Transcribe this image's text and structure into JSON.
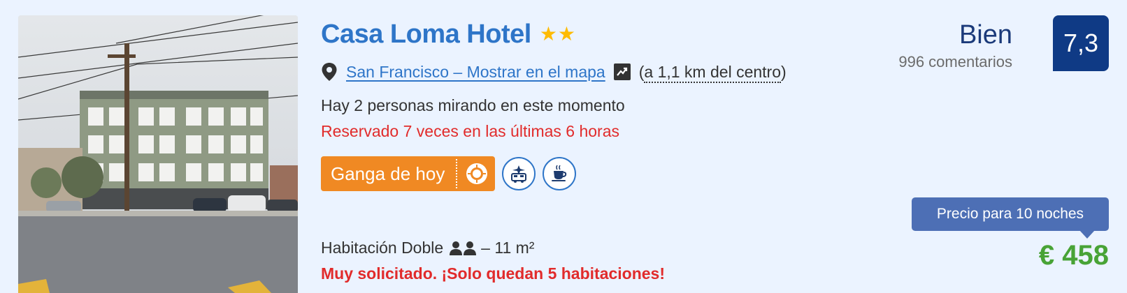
{
  "hotel": {
    "name": "Casa Loma Hotel",
    "stars": 2,
    "star_color": "#febb02",
    "name_color": "#2e75c8"
  },
  "location": {
    "map_link": "San Francisco – Mostrar en el mapa",
    "distance": "a 1,1 km del centro",
    "open_paren": "(",
    "close_paren": ")",
    "icons": [
      "map-pin-icon",
      "map-view-icon"
    ]
  },
  "activity": {
    "viewers": "Hay 2 personas mirando en este momento",
    "booked": "Reservado 7 veces en las últimas 6 horas"
  },
  "badges": {
    "deal_label": "Ganga de hoy",
    "deal_color": "#f08923",
    "icons": [
      "deal-sun-icon",
      "airport-shuttle-icon",
      "coffee-cup-icon"
    ]
  },
  "room": {
    "name": "Habitación Doble",
    "size": "– 11 m²",
    "occupancy_icon": "two-people-icon",
    "scarcity": "Muy solicitado. ¡Solo quedan 5 habitaciones!"
  },
  "rating": {
    "label": "Bien",
    "reviews": "996 comentarios",
    "score": "7,3",
    "badge_color": "#0f3a85"
  },
  "price": {
    "tooltip": "Precio para 10 noches",
    "amount": "€ 458",
    "color": "#48a336"
  }
}
